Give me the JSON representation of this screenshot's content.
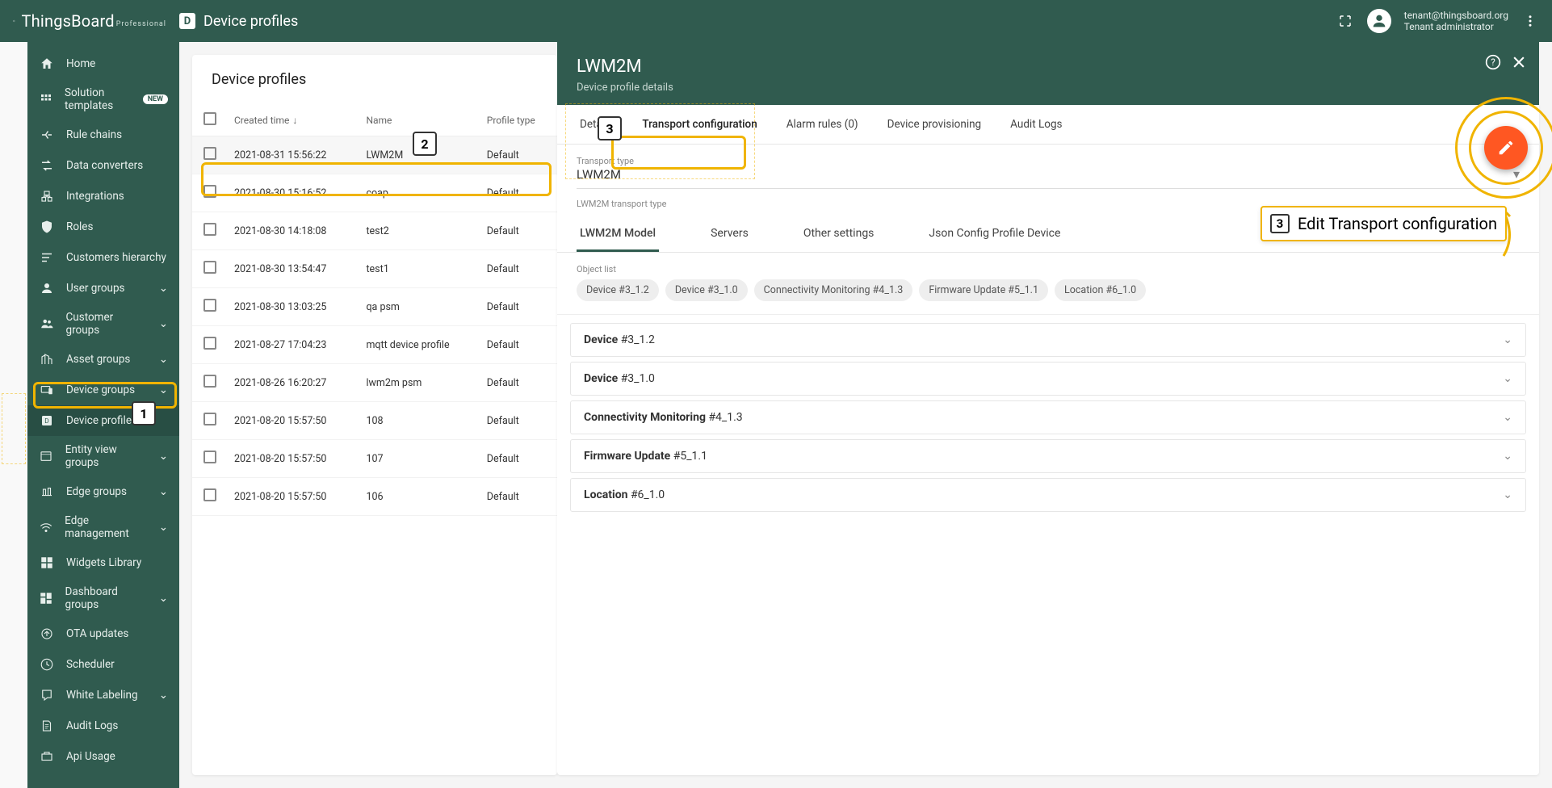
{
  "brand": {
    "name": "ThingsBoard",
    "edition": "Professional"
  },
  "breadcrumb": {
    "icon": "D",
    "title": "Device profiles"
  },
  "user": {
    "email": "tenant@thingsboard.org",
    "role": "Tenant administrator"
  },
  "sidebar": {
    "items": [
      {
        "label": "Home",
        "icon": "home"
      },
      {
        "label": "Solution templates",
        "icon": "grid",
        "badge": "NEW"
      },
      {
        "label": "Rule chains",
        "icon": "rules"
      },
      {
        "label": "Data converters",
        "icon": "convert"
      },
      {
        "label": "Integrations",
        "icon": "integrations"
      },
      {
        "label": "Roles",
        "icon": "shield"
      },
      {
        "label": "Customers hierarchy",
        "icon": "hierarchy"
      },
      {
        "label": "User groups",
        "icon": "user",
        "expand": true
      },
      {
        "label": "Customer groups",
        "icon": "group",
        "expand": true
      },
      {
        "label": "Asset groups",
        "icon": "city",
        "expand": true
      },
      {
        "label": "Device groups",
        "icon": "devices",
        "expand": true
      },
      {
        "label": "Device profiles",
        "icon": "dp",
        "active": true
      },
      {
        "label": "Entity view groups",
        "icon": "entity",
        "expand": true
      },
      {
        "label": "Edge groups",
        "icon": "edge",
        "expand": true
      },
      {
        "label": "Edge management",
        "icon": "edgem",
        "expand": true
      },
      {
        "label": "Widgets Library",
        "icon": "widgets"
      },
      {
        "label": "Dashboard groups",
        "icon": "dash",
        "expand": true
      },
      {
        "label": "OTA updates",
        "icon": "ota"
      },
      {
        "label": "Scheduler",
        "icon": "sched"
      },
      {
        "label": "White Labeling",
        "icon": "wl",
        "expand": true
      },
      {
        "label": "Audit Logs",
        "icon": "audit"
      },
      {
        "label": "Api Usage",
        "icon": "api"
      }
    ]
  },
  "list": {
    "title": "Device profiles",
    "columns": {
      "created": "Created time",
      "name": "Name",
      "type": "Profile type"
    },
    "rows": [
      {
        "time": "2021-08-31 15:56:22",
        "name": "LWM2M",
        "type": "Default",
        "selected": true
      },
      {
        "time": "2021-08-30 15:16:52",
        "name": "coap",
        "type": "Default"
      },
      {
        "time": "2021-08-30 14:18:08",
        "name": "test2",
        "type": "Default"
      },
      {
        "time": "2021-08-30 13:54:47",
        "name": "test1",
        "type": "Default"
      },
      {
        "time": "2021-08-30 13:03:25",
        "name": "qa psm",
        "type": "Default"
      },
      {
        "time": "2021-08-27 17:04:23",
        "name": "mqtt device profile",
        "type": "Default"
      },
      {
        "time": "2021-08-26 16:20:27",
        "name": "lwm2m psm",
        "type": "Default"
      },
      {
        "time": "2021-08-20 15:57:50",
        "name": "108",
        "type": "Default"
      },
      {
        "time": "2021-08-20 15:57:50",
        "name": "107",
        "type": "Default"
      },
      {
        "time": "2021-08-20 15:57:50",
        "name": "106",
        "type": "Default"
      }
    ]
  },
  "detail": {
    "title": "LWM2M",
    "subtitle": "Device profile details",
    "tabs": [
      "Details",
      "Transport configuration",
      "Alarm rules (0)",
      "Device provisioning",
      "Audit Logs"
    ],
    "activeTab": 1,
    "transportTypeLabel": "Transport type",
    "transportType": "LWM2M",
    "lwm2mLabel": "LWM2M transport type",
    "subtabs": [
      "LWM2M Model",
      "Servers",
      "Other settings",
      "Json Config Profile Device"
    ],
    "activeSubtab": 0,
    "objectListLabel": "Object list",
    "chips": [
      "Device #3_1.2",
      "Device #3_1.0",
      "Connectivity Monitoring #4_1.3",
      "Firmware Update #5_1.1",
      "Location #6_1.0"
    ],
    "accordion": [
      {
        "bold": "Device",
        "rest": " #3_1.2"
      },
      {
        "bold": "Device",
        "rest": " #3_1.0"
      },
      {
        "bold": "Connectivity Monitoring",
        "rest": " #4_1.3"
      },
      {
        "bold": "Firmware Update",
        "rest": " #5_1.1"
      },
      {
        "bold": "Location",
        "rest": " #6_1.0"
      }
    ]
  },
  "annotations": {
    "tip3": "Edit Transport configuration"
  }
}
